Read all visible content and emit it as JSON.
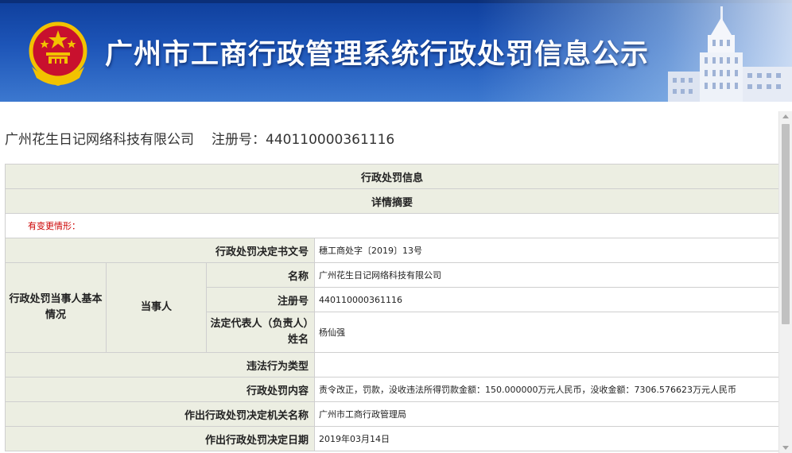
{
  "banner": {
    "title": "广州市工商行政管理系统行政处罚信息公示"
  },
  "company": {
    "name": "广州花生日记网络科技有限公司",
    "reg_label": "注册号：",
    "reg_no": "440110000361116"
  },
  "table": {
    "section_title": "行政处罚信息",
    "summary_title": "详情摘要",
    "change_note": "有变更情形：",
    "decision_no_label": "行政处罚决定书文号",
    "decision_no": "穗工商处字〔2019〕13号",
    "party_group_label": "行政处罚当事人基本情况",
    "party_label": "当事人",
    "name_label": "名称",
    "name_value": "广州花生日记网络科技有限公司",
    "reg_label": "注册号",
    "reg_value": "440110000361116",
    "rep_label": "法定代表人（负责人）姓名",
    "rep_value": "杨仙强",
    "violation_type_label": "违法行为类型",
    "violation_type_value": "",
    "content_label": "行政处罚内容",
    "content_value": "责令改正，罚款，没收违法所得罚款金额：150.000000万元人民币，没收金额：7306.576623万元人民币",
    "authority_label": "作出行政处罚决定机关名称",
    "authority_value": "广州市工商行政管理局",
    "date_label": "作出行政处罚决定日期",
    "date_value": "2019年03月14日"
  },
  "colors": {
    "banner_blue": "#1d55b8",
    "label_bg": "#eceee2",
    "change_red": "#cc0000"
  }
}
